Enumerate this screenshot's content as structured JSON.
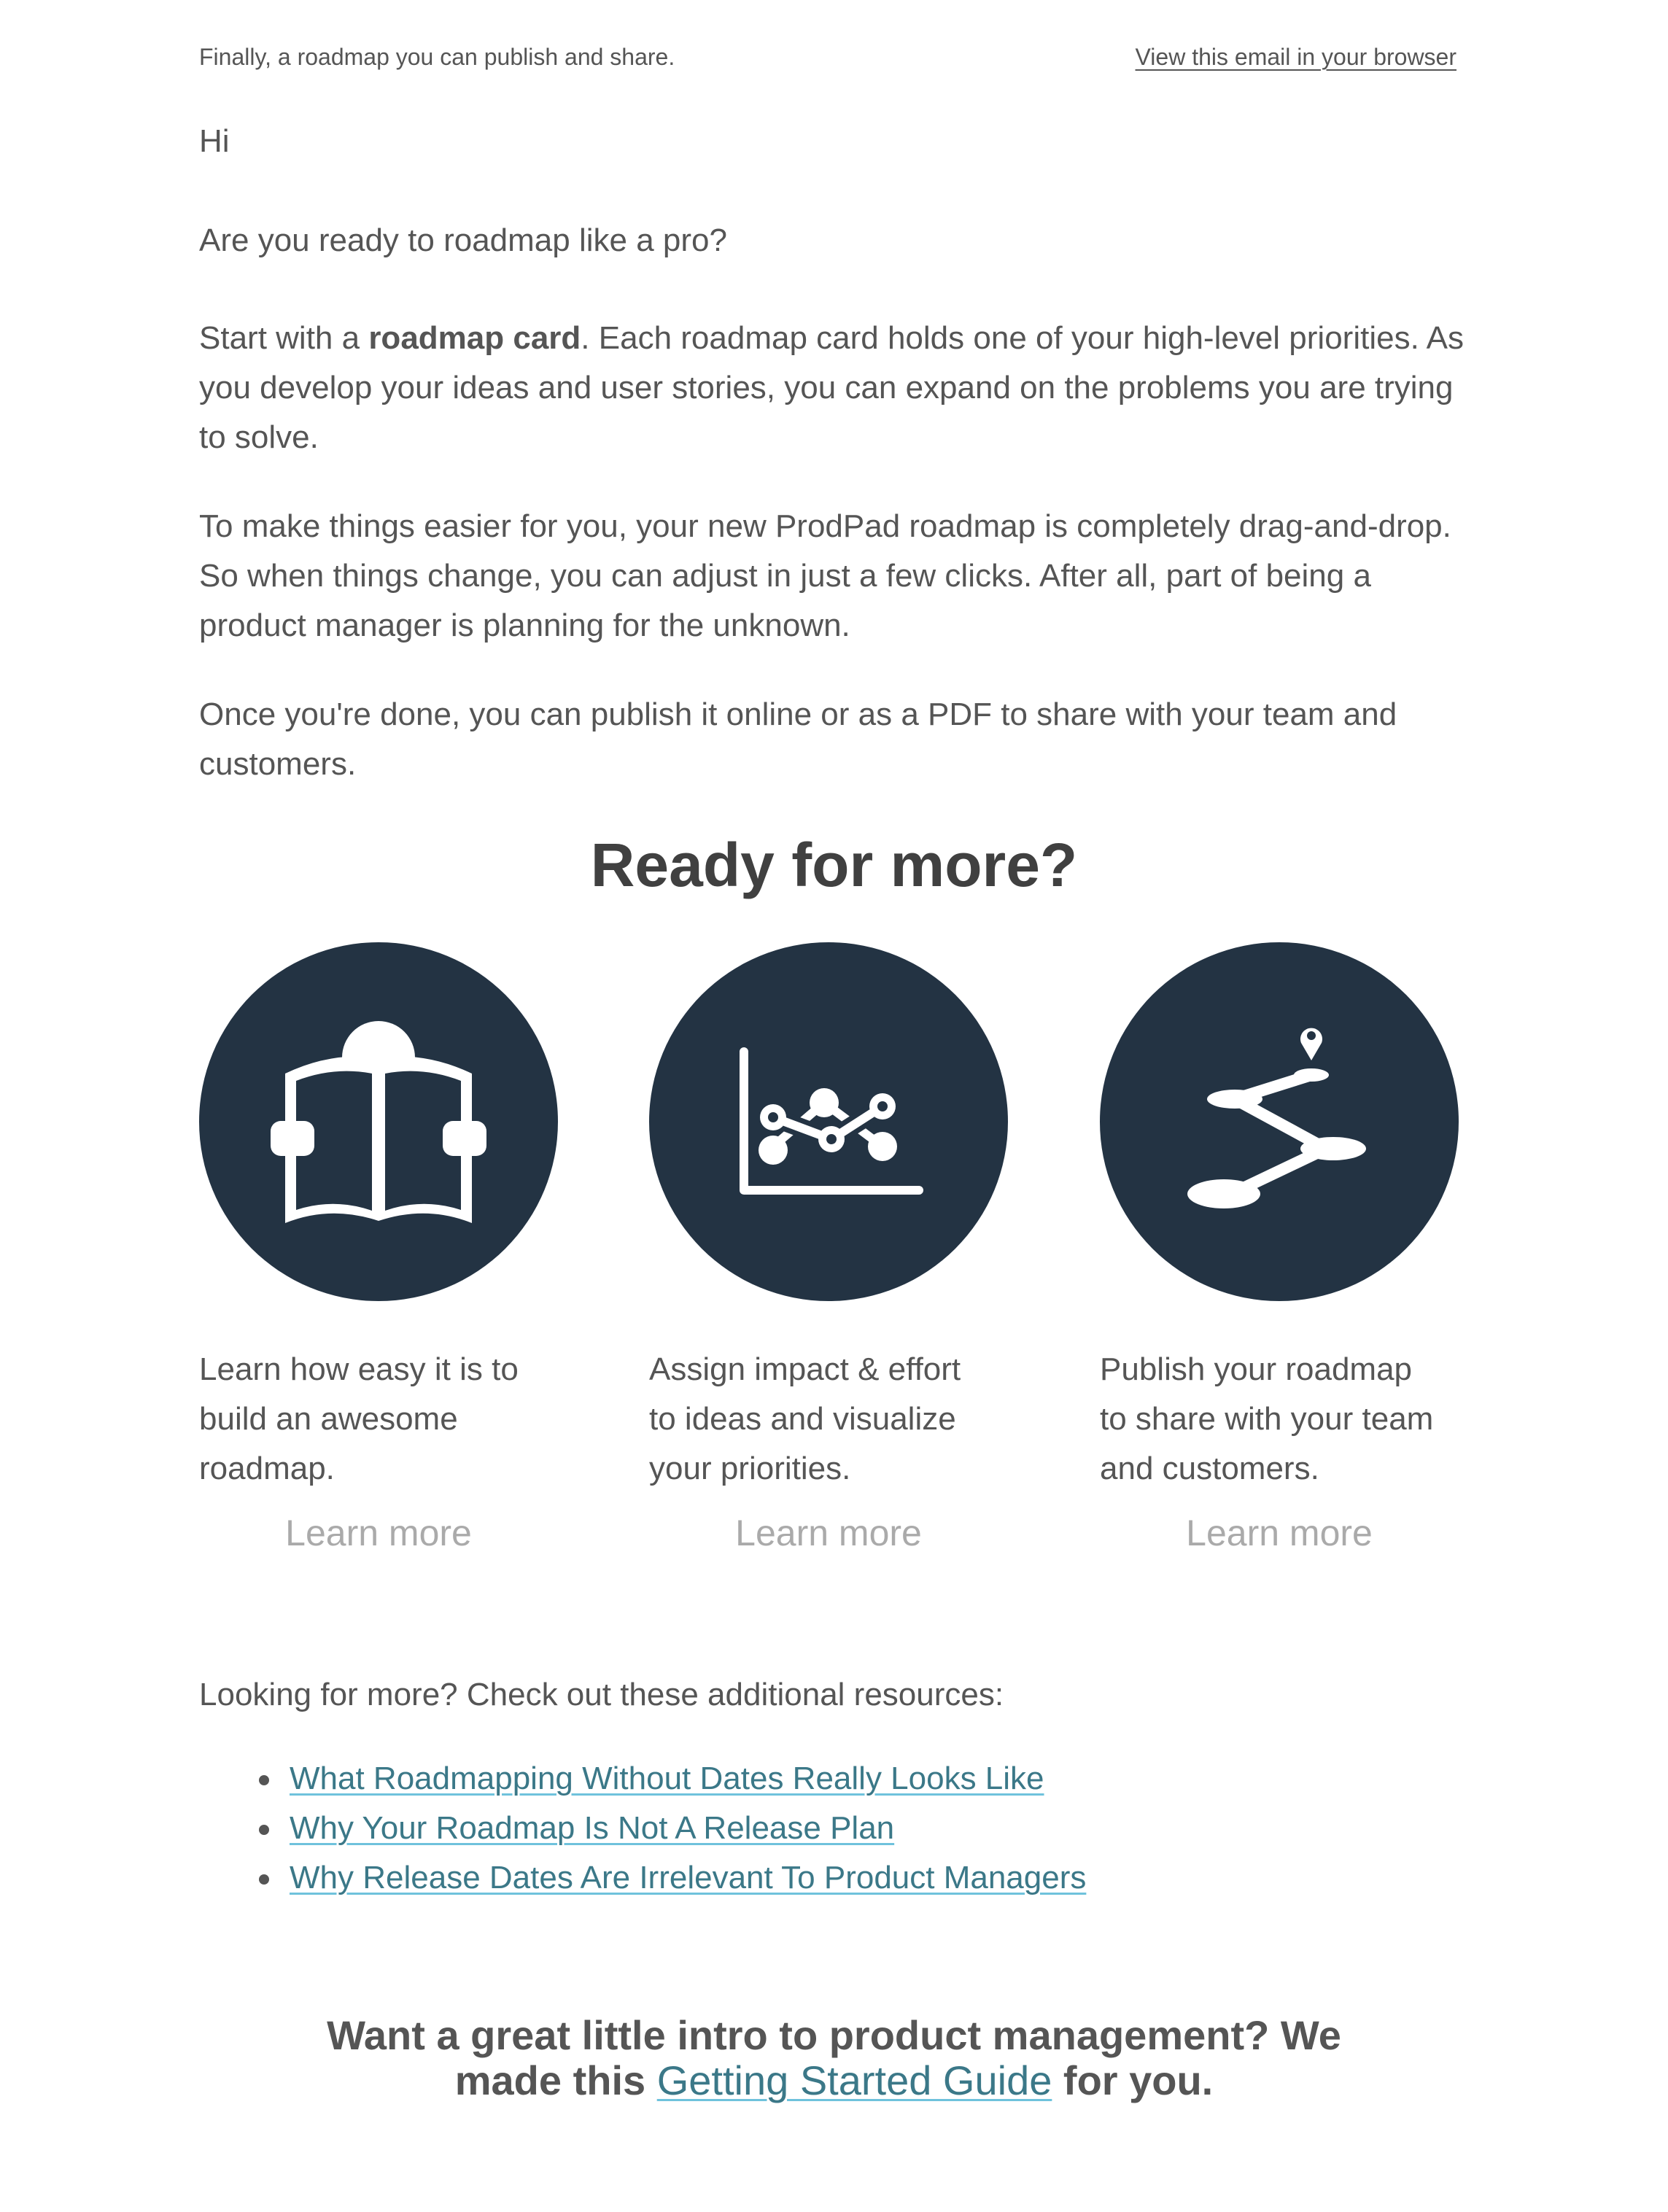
{
  "preheader": {
    "tagline": "Finally, a roadmap you can publish and share.",
    "view_in_browser": "View this email in your browser"
  },
  "greeting": "Hi",
  "intro_question": "Are you ready to roadmap like a pro?",
  "paragraph1": {
    "prefix": "Start with a ",
    "bold": "roadmap card",
    "suffix": ". Each roadmap card holds one of your high-level priorities. As you develop your ideas and user stories, you can expand on the problems you are trying to solve."
  },
  "paragraph2": "To make things easier for you, your new ProdPad roadmap is completely drag-and-drop. So when things change, you can adjust in just a few clicks. After all, part of being a product manager is planning for the unknown.",
  "paragraph3": "Once you're done, you can publish it online or as a PDF to share with your team and customers.",
  "section_heading": "Ready for more?",
  "features": [
    {
      "icon": "reader-book-icon",
      "text": "Learn how easy it is to build an awesome roadmap.",
      "cta": "Learn more"
    },
    {
      "icon": "line-chart-icon",
      "text": "Assign impact & effort to ideas and visualize your priorities.",
      "cta": "Learn more"
    },
    {
      "icon": "roadmap-path-icon",
      "text": "Publish your roadmap to share with your team and customers.",
      "cta": "Learn more"
    }
  ],
  "resources": {
    "intro": "Looking for more? Check out these additional resources:",
    "links": [
      "What Roadmapping Without Dates Really Looks Like",
      "Why Your Roadmap Is Not A Release Plan",
      "Why Release Dates Are Irrelevant To Product Managers"
    ]
  },
  "footer": {
    "prefix": "Want a great little intro to product management? We made this ",
    "link": "Getting Started Guide",
    "suffix": " for you."
  },
  "colors": {
    "text": "#555555",
    "heading": "#404040",
    "circle": "#233343",
    "link": "#3b7888",
    "link_underline": "#6fc2dc",
    "cta": "#aaaaaa"
  }
}
